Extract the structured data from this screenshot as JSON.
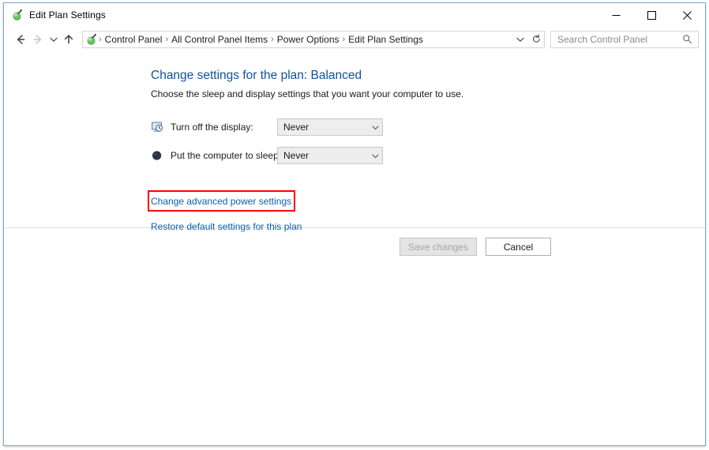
{
  "window": {
    "title": "Edit Plan Settings",
    "title_icon": "power-plan-icon",
    "minimize_label": "Minimize",
    "maximize_label": "Maximize",
    "close_label": "Close"
  },
  "nav": {
    "back_icon": "back-arrow-icon",
    "forward_icon": "forward-arrow-icon",
    "recent_icon": "recent-locations-chevron-icon",
    "up_icon": "up-arrow-icon",
    "address_icon": "power-plan-icon",
    "breadcrumbs": [
      "Control Panel",
      "All Control Panel Items",
      "Power Options",
      "Edit Plan Settings"
    ],
    "separator": "›",
    "dropdown_icon": "chevron-down-icon",
    "refresh_icon": "refresh-icon"
  },
  "search": {
    "placeholder": "Search Control Panel",
    "value": "",
    "icon": "search-icon"
  },
  "main": {
    "title": "Change settings for the plan: Balanced",
    "subtitle": "Choose the sleep and display settings that you want your computer to use.",
    "settings": [
      {
        "icon": "display-off-icon",
        "label": "Turn off the display:",
        "value": "Never",
        "arrow_icon": "chevron-down-icon"
      },
      {
        "icon": "sleep-moon-icon",
        "label": "Put the computer to sleep:",
        "value": "Never",
        "arrow_icon": "chevron-down-icon"
      }
    ],
    "links": [
      {
        "label": "Change advanced power settings",
        "highlighted": true
      },
      {
        "label": "Restore default settings for this plan",
        "highlighted": false
      }
    ]
  },
  "footer": {
    "save_label": "Save changes",
    "save_enabled": false,
    "cancel_label": "Cancel",
    "cancel_enabled": true
  },
  "colors": {
    "window_border": "#7aa9d8",
    "heading": "#12509c",
    "link": "#0a5fb0",
    "annotation": "#fe0000",
    "combo_bg": "#ededed"
  }
}
